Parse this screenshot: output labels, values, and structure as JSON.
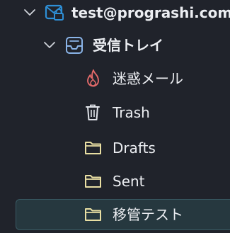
{
  "folder_tree": {
    "account": {
      "label": "test@prograshi.com",
      "icon": "account-envelope-lock-icon",
      "expanded": true
    },
    "inbox": {
      "label": "受信トレイ",
      "icon": "inbox-icon",
      "expanded": true
    },
    "folders": [
      {
        "label": "迷惑メール",
        "icon": "junk-flame-icon",
        "selected": false
      },
      {
        "label": "Trash",
        "icon": "trash-icon",
        "selected": false
      },
      {
        "label": "Drafts",
        "icon": "folder-icon",
        "selected": false
      },
      {
        "label": "Sent",
        "icon": "folder-icon",
        "selected": false
      },
      {
        "label": "移管テスト",
        "icon": "folder-icon",
        "selected": true
      }
    ]
  },
  "colors": {
    "background": "#20232b",
    "account_icon": "#2e8fd6",
    "inbox_icon": "#8ab4e8",
    "junk_icon": "#e36a6a",
    "folder_icon": "#e9dfa3",
    "selected_background": "#26383f",
    "selected_border": "#395a63"
  }
}
